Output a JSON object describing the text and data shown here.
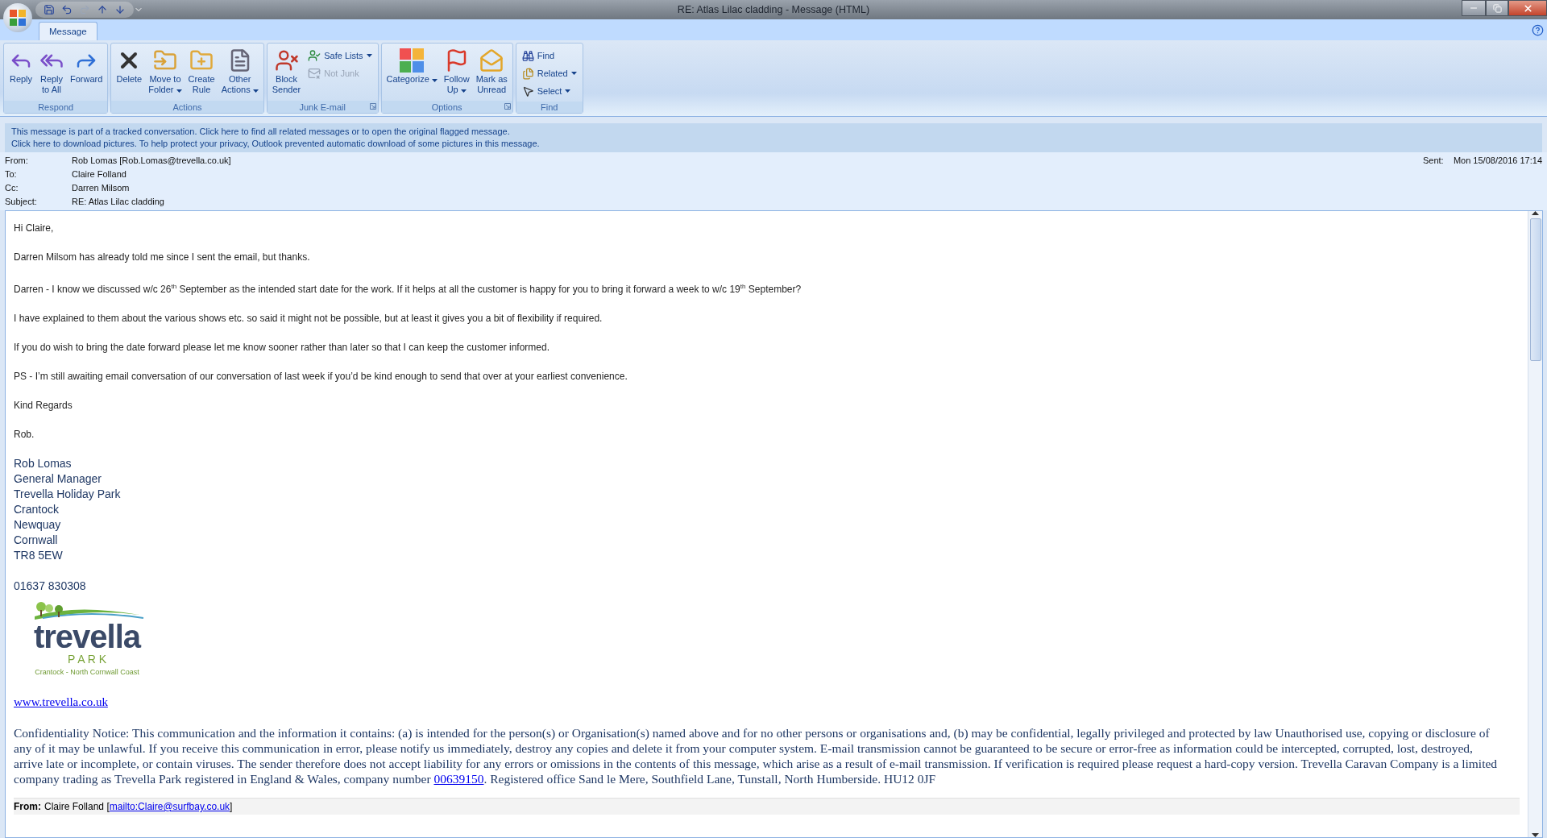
{
  "window": {
    "title": "RE: Atlas Lilac  cladding - Message (HTML)"
  },
  "tabs": [
    {
      "label": "Message",
      "selected": true
    }
  ],
  "ribbon": [
    {
      "label": "Respond",
      "launcher": false,
      "buttons": [
        {
          "kind": "large",
          "label": "Reply",
          "dropdown": false,
          "disabled": false
        },
        {
          "kind": "large",
          "label": "Reply\nto All",
          "dropdown": false,
          "disabled": false
        },
        {
          "kind": "large",
          "label": "Forward",
          "dropdown": false,
          "disabled": false
        }
      ]
    },
    {
      "label": "Actions",
      "launcher": false,
      "buttons": [
        {
          "kind": "large",
          "label": "Delete",
          "dropdown": false,
          "disabled": false
        },
        {
          "kind": "large",
          "label": "Move to\nFolder",
          "dropdown": true,
          "disabled": false
        },
        {
          "kind": "large",
          "label": "Create\nRule",
          "dropdown": false,
          "disabled": false
        },
        {
          "kind": "large",
          "label": "Other\nActions",
          "dropdown": true,
          "disabled": false
        }
      ]
    },
    {
      "label": "Junk E-mail",
      "launcher": true,
      "buttons": [
        {
          "kind": "large",
          "label": "Block\nSender",
          "dropdown": false,
          "disabled": false
        },
        {
          "kind": "small",
          "label": "Safe Lists",
          "dropdown": true,
          "disabled": false
        },
        {
          "kind": "small",
          "label": "Not Junk",
          "dropdown": false,
          "disabled": true
        }
      ]
    },
    {
      "label": "Options",
      "launcher": true,
      "buttons": [
        {
          "kind": "large",
          "label": "Categorize",
          "dropdown": true,
          "disabled": false
        },
        {
          "kind": "large",
          "label": "Follow\nUp",
          "dropdown": true,
          "disabled": false
        },
        {
          "kind": "large",
          "label": "Mark as\nUnread",
          "dropdown": false,
          "disabled": false
        }
      ]
    },
    {
      "label": "Find",
      "launcher": false,
      "buttons": [
        {
          "kind": "small",
          "label": "Find",
          "dropdown": false,
          "disabled": false
        },
        {
          "kind": "small",
          "label": "Related",
          "dropdown": true,
          "disabled": false
        },
        {
          "kind": "small",
          "label": "Select",
          "dropdown": true,
          "disabled": false
        }
      ]
    }
  ],
  "info_bar": [
    "This message is part of a tracked conversation. Click here to find all related messages or to open the original flagged message.",
    "Click here to download pictures. To help protect your privacy, Outlook prevented automatic download of some pictures in this message."
  ],
  "headers": [
    {
      "label": "From:",
      "value": "Rob Lomas [Rob.Lomas@trevella.co.uk]"
    },
    {
      "label": "To:",
      "value": "Claire Folland"
    },
    {
      "label": "Cc:",
      "value": "Darren Milsom"
    },
    {
      "label": "Subject:",
      "value": "RE: Atlas Lilac  cladding"
    }
  ],
  "sent": {
    "label": "Sent:",
    "value": "Mon 15/08/2016 17:14"
  },
  "body": {
    "paragraphs": [
      "Hi Claire,",
      "Darren Milsom has already told me since I sent the email, but thanks.",
      "Darren - I know we discussed w/c 26$^{th}$ September as the intended start date for the work. If it helps at all the customer is happy for you to bring it forward a week to w/c 19$^{th}$ September?",
      "I have explained to them about the various shows etc. so said it might not be possible, but at least it gives you a bit of flexibility if required.",
      "If you do wish to bring the date forward please let me know sooner rather than later so that I can keep the customer informed.",
      "PS - I’m still awaiting email conversation of our conversation of last week if you’d be kind enough to send that over at your earliest convenience.",
      "Kind Regards",
      "Rob."
    ],
    "signature": [
      "Rob Lomas",
      "General Manager",
      "Trevella Holiday Park",
      "Crantock",
      "Newquay",
      "Cornwall",
      "TR8 5EW"
    ],
    "phone": "01637 830308",
    "logo": {
      "name": "trevella",
      "sub": "P A R K",
      "tagline": "Crantock - North Cornwall Coast"
    },
    "website": "www.trevella.co.uk",
    "disclaimer": {
      "before": "Confidentiality Notice: This communication and the information it contains: (a) is intended for the person(s) or Organisation(s) named above and for no other persons or organisations and, (b) may be confidential, legally privileged and protected by law Unauthorised use, copying or disclosure of any of it may be unlawful. If you receive this communication in error, please notify us immediately, destroy any copies and delete it from your computer system. E-mail transmission cannot be guaranteed to be secure or error-free as information could be intercepted, corrupted, lost, destroyed, arrive late or incomplete, or contain viruses. The sender therefore does not accept liability for any errors or omissions in the contents of this message, which arise as a result of e-mail transmission. If verification is required please request a hard-copy version. Trevella Caravan Company is a limited company trading as Trevella Park registered in England & Wales, company number ",
      "link": "00639150",
      "after": ". Registered office Sand le Mere, Southfield Lane, Tunstall, North Humberside. HU12 0JF"
    },
    "quoted": {
      "label": "From:",
      "name": "Claire Folland",
      "open": "[",
      "link": "mailto:Claire@surfbay.co.uk",
      "close": "]"
    }
  }
}
